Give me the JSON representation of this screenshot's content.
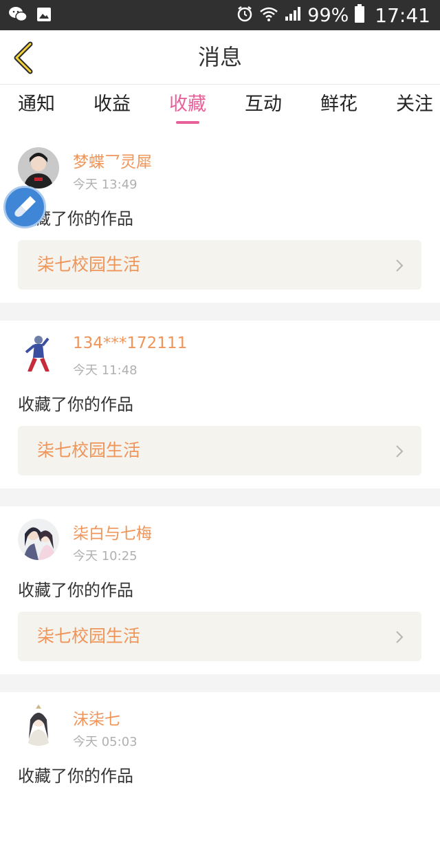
{
  "status_bar": {
    "icons_left": [
      "wechat-icon",
      "gallery-icon"
    ],
    "icons_right": [
      "alarm-icon",
      "wifi-icon",
      "signal-icon",
      "battery-icon"
    ],
    "battery": "99%",
    "time": "17:41"
  },
  "header": {
    "title": "消息",
    "back_icon": "chevron-left-icon",
    "accent_color": "#e8609a"
  },
  "tabs": [
    {
      "label": "通知",
      "active": false
    },
    {
      "label": "收益",
      "active": false
    },
    {
      "label": "收藏",
      "active": true
    },
    {
      "label": "互动",
      "active": false
    },
    {
      "label": "鲜花",
      "active": false
    },
    {
      "label": "关注",
      "active": false
    }
  ],
  "messages": [
    {
      "user": "梦蝶乛灵犀",
      "time": "今天 13:49",
      "action": "收藏了你的作品",
      "work": "柒七校园生活"
    },
    {
      "user": "134***172111",
      "time": "今天 11:48",
      "action": "收藏了你的作品",
      "work": "柒七校园生活"
    },
    {
      "user": "柒白与七梅",
      "time": "今天 10:25",
      "action": "收藏了你的作品",
      "work": "柒七校园生活"
    },
    {
      "user": "沫柒七",
      "time": "今天 05:03",
      "action": "收藏了你的作品",
      "work": ""
    }
  ],
  "floating_button": {
    "icon": "brush-icon"
  }
}
